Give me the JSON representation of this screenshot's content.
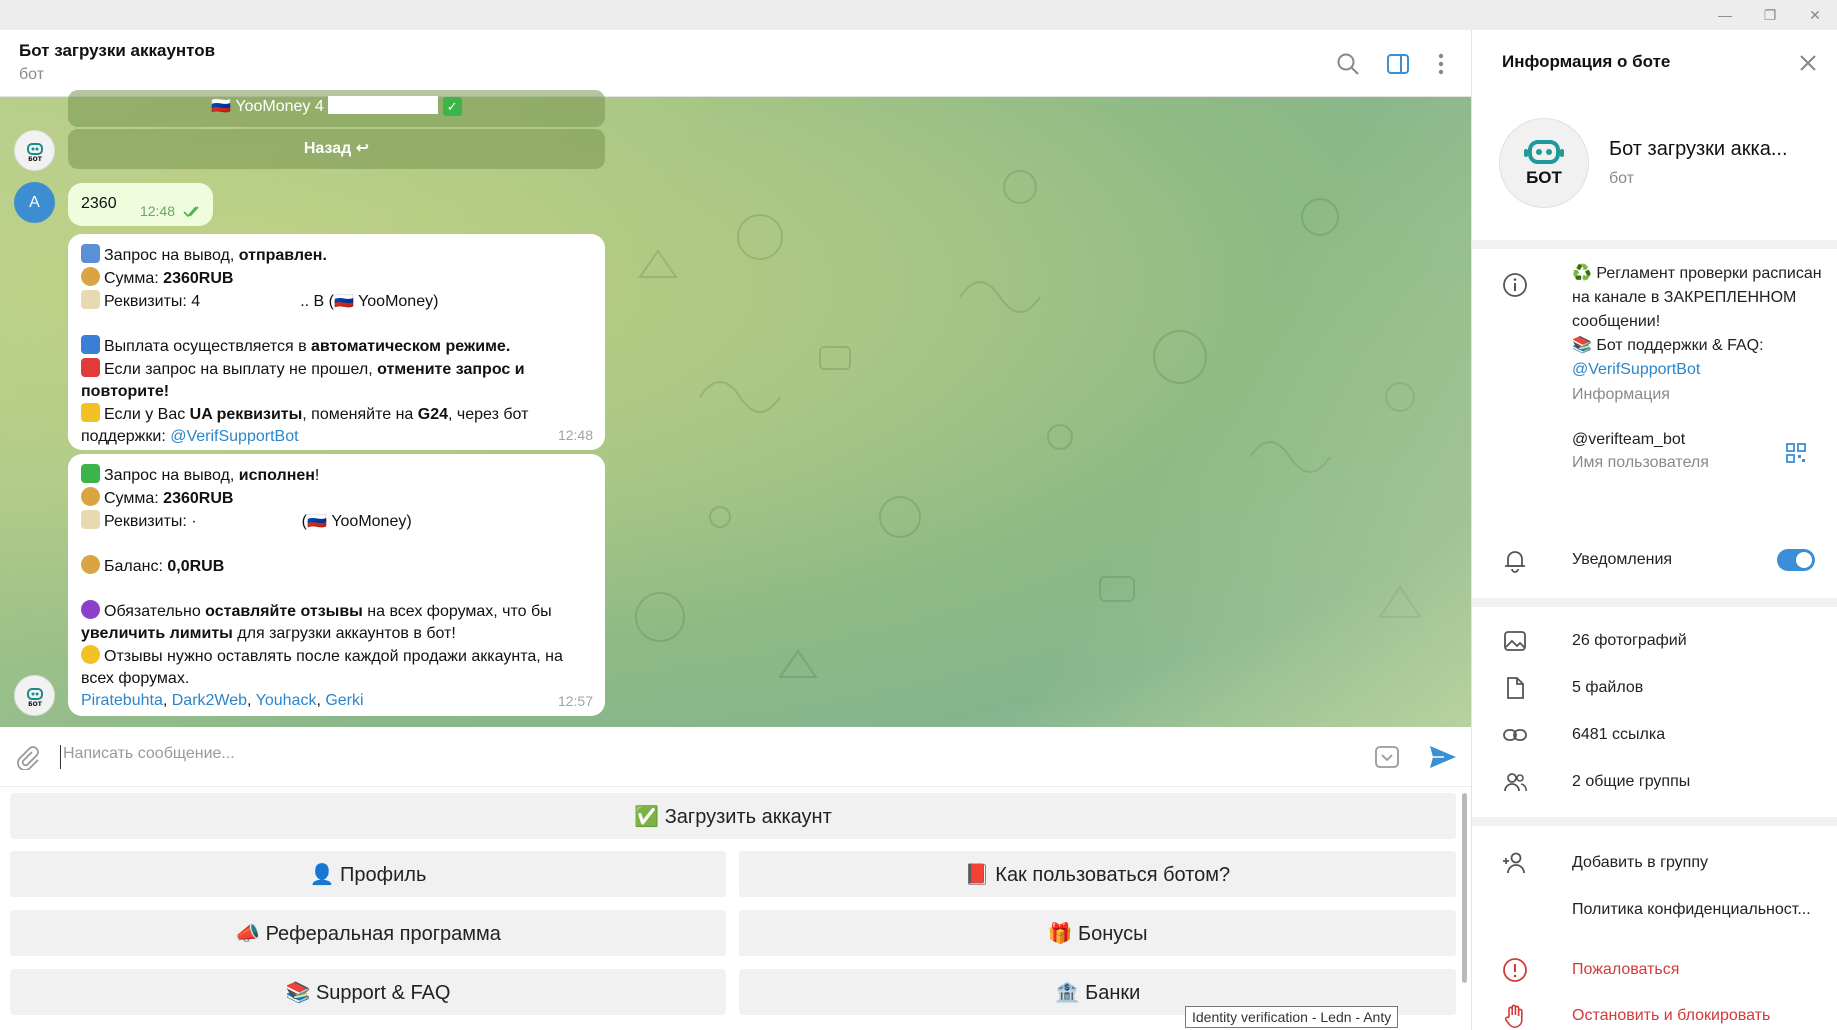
{
  "chat": {
    "title": "Бот загрузки аккаунтов",
    "subtitle": "бот",
    "prev_button_partial": "YooMoney 4",
    "back_button": "Назад ↩",
    "user_avatar_letter": "A",
    "user_message": "2360",
    "user_message_time": "12:48",
    "bot_avatar_text": "БОТ"
  },
  "msg1": {
    "l1_a": "Запрос на вывод, ",
    "l1_b": "отправлен.",
    "l2_a": "Сумма: ",
    "l2_b": "2360RUB",
    "l3_a": "Реквизиты: 4",
    "l3_c": ".. B (",
    "l3_d": " YooMoney)",
    "l4_a": "Выплата осуществляется в ",
    "l4_b": "автоматическом режиме.",
    "l5_a": "Если запрос на выплату не прошел, ",
    "l5_b": "отмените запрос и повторите!",
    "l6_a": "Если у Вас ",
    "l6_b": "UA реквизиты",
    "l6_c": ", поменяйте на ",
    "l6_d": "G24",
    "l6_e": ", через бот поддержки: ",
    "l6_link": "@VerifSupportBot",
    "time": "12:48"
  },
  "msg2": {
    "l1_a": "Запрос на вывод, ",
    "l1_b": "исполнен",
    "l1_c": "!",
    "l2_a": "Сумма: ",
    "l2_b": "2360RUB",
    "l3_a": "Реквизиты: ·",
    "l3_c": "(",
    "l3_d": " YooMoney)",
    "l4_a": "Баланс: ",
    "l4_b": "0,0RUB",
    "l5_a": "Обязательно ",
    "l5_b": "оставляйте отзывы",
    "l5_c": " на всех форумах, что бы ",
    "l5_d": "увеличить лимиты",
    "l5_e": " для загрузки аккаунтов в бот!",
    "l6": "Отзывы нужно оставлять после каждой продажи аккаунта, на всех форумах.",
    "links": [
      "Piratebuhta",
      "Dark2Web",
      "Youhack",
      "Gerki"
    ],
    "time": "12:57"
  },
  "composer": {
    "placeholder": "Написать сообщение..."
  },
  "keyboard": {
    "upload": "✅ Загрузить аккаунт",
    "profile": "👤 Профиль",
    "howto": "📕 Как пользоваться ботом?",
    "referral": "📣 Реферальная программа",
    "bonuses": "🎁 Бонусы",
    "support": "📚 Support & FAQ",
    "banks": "🏦 Банки"
  },
  "tooltip": "Identity verification - Ledn - Anty",
  "panel": {
    "title": "Информация о боте",
    "name": "Бот загрузки акка...",
    "sub": "бот",
    "info_text_1": "♻️ Регламент проверки расписан на канале в ЗАКРЕПЛЕННОМ сообщении!",
    "info_text_2": "📚 Бот поддержки & FAQ:",
    "info_link": "@VerifSupportBot",
    "info_label": "Информация",
    "username": "@verifteam_bot",
    "username_label": "Имя пользователя",
    "notifications": "Уведомления",
    "notifications_on": true,
    "photos": "26 фотографий",
    "files": "5 файлов",
    "links": "6481 ссылка",
    "groups": "2 общие группы",
    "add_to_group": "Добавить в группу",
    "privacy": "Политика конфиденциальност...",
    "report": "Пожаловаться",
    "block": "Остановить и блокировать"
  },
  "colors": {
    "accent": "#3a8fd6",
    "link": "#2a85c9",
    "danger": "#d33a3a",
    "outgoing": "#effdde"
  }
}
